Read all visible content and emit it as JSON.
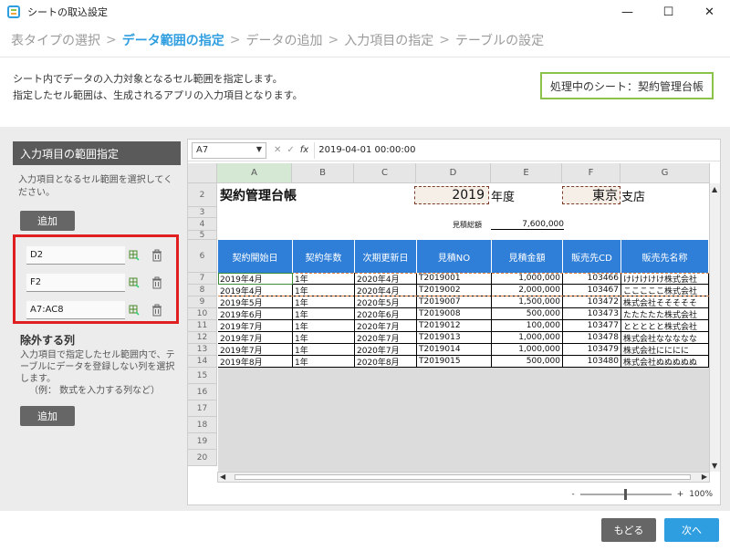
{
  "window": {
    "title": "シートの取込設定",
    "minimize": "—",
    "maximize": "☐",
    "close": "✕"
  },
  "steps": [
    {
      "label": "表タイプの選択",
      "active": false
    },
    {
      "label": "データ範囲の指定",
      "active": true
    },
    {
      "label": "データの追加",
      "active": false
    },
    {
      "label": "入力項目の指定",
      "active": false
    },
    {
      "label": "テーブルの設定",
      "active": false
    }
  ],
  "step_separator": ">",
  "description": {
    "line1": "シート内でデータの入力対象となるセル範囲を指定します。",
    "line2": "指定したセル範囲は、生成されるアプリの入力項目となります。"
  },
  "current_sheet": "処理中のシート：契約管理台帳",
  "left_panel": {
    "header": "入力項目の範囲指定",
    "hint": "入力項目となるセル範囲を選択してください。",
    "add_button": "追加",
    "ranges": [
      "D2",
      "F2",
      "A7:AC8"
    ],
    "exclude_title": "除外する列",
    "exclude_hint": "入力項目で指定したセル範囲内で、テーブルにデータを登録しない列を選択します。",
    "exclude_example": "（例： 数式を入力する列など）",
    "exclude_add_button": "追加"
  },
  "formula_bar": {
    "name_box": "A7",
    "fx": "fx",
    "cancel": "✕",
    "confirm": "✓",
    "value": "2019-04-01 00:00:00"
  },
  "columns": [
    "A",
    "B",
    "C",
    "D",
    "E",
    "F",
    "G"
  ],
  "row_numbers": [
    "2",
    "3",
    "4",
    "5",
    "6",
    "7",
    "8",
    "9",
    "10",
    "11",
    "12",
    "13",
    "14",
    "15",
    "16",
    "17",
    "18",
    "19",
    "20"
  ],
  "sheet": {
    "title": "契約管理台帳",
    "year_value": "2019",
    "year_suffix": "年度",
    "branch_value": "東京",
    "branch_suffix": "支店",
    "total_label": "見積総額",
    "total_value": "7,600,000",
    "headers": [
      "契約開始日",
      "契約年数",
      "次期更新日",
      "見積NO",
      "見積金額",
      "販売先CD",
      "販売先名称"
    ],
    "rows": [
      [
        "2019年4月",
        "1年",
        "2020年4月",
        "T2019001",
        "1,000,000",
        "103466",
        "けけけけけ株式会社"
      ],
      [
        "2019年4月",
        "1年",
        "2020年4月",
        "T2019002",
        "2,000,000",
        "103467",
        "こここここ株式会社"
      ],
      [
        "2019年5月",
        "1年",
        "2020年5月",
        "T2019007",
        "1,500,000",
        "103472",
        "株式会社そそそそそ"
      ],
      [
        "2019年6月",
        "1年",
        "2020年6月",
        "T2019008",
        "500,000",
        "103473",
        "たたたたた株式会社"
      ],
      [
        "2019年7月",
        "1年",
        "2020年7月",
        "T2019012",
        "100,000",
        "103477",
        "ととととと株式会社"
      ],
      [
        "2019年7月",
        "1年",
        "2020年7月",
        "T2019013",
        "1,000,000",
        "103478",
        "株式会社ななななな"
      ],
      [
        "2019年7月",
        "1年",
        "2020年7月",
        "T2019014",
        "1,000,000",
        "103479",
        "株式会社にににに"
      ],
      [
        "2019年8月",
        "1年",
        "2020年8月",
        "T2019015",
        "500,000",
        "103480",
        "株式会社ぬぬぬぬぬ"
      ]
    ]
  },
  "zoom": {
    "minus": "-",
    "plus": "+",
    "level": "100%"
  },
  "footer": {
    "back": "もどる",
    "next": "次へ"
  },
  "colors": {
    "accent": "#2f9ee0",
    "sheet_header": "#2f7fd8",
    "highlight": "#e02020",
    "green": "#8bc34a"
  }
}
